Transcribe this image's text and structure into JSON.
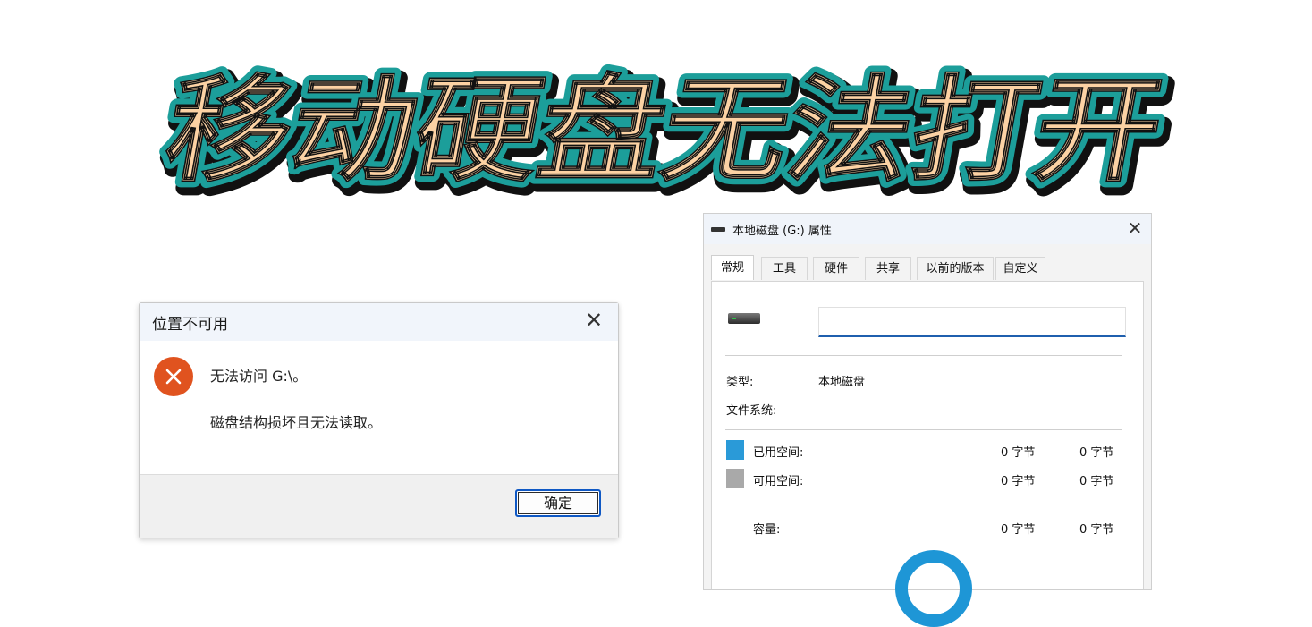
{
  "headline": "移动硬盘无法打开",
  "colors": {
    "headline_fill": "#fcd2a4",
    "headline_stroke": "#1c9e9a",
    "error_red": "#e0531f",
    "used_space": "#2a9ad8",
    "free_space": "#a9a9a9",
    "accent_blue": "#1f5fae"
  },
  "error_dialog": {
    "title": "位置不可用",
    "close_icon": "close-icon",
    "icon": "error-icon",
    "line1": "无法访问 G:\\。",
    "line2": "磁盘结构损坏且无法读取。",
    "ok_button": "确定"
  },
  "properties_dialog": {
    "title": "本地磁盘 (G:) 属性",
    "close_icon": "close-icon",
    "tabs": [
      "常规",
      "工具",
      "硬件",
      "共享",
      "以前的版本",
      "自定义"
    ],
    "active_tab": "常规",
    "volume_label_value": "",
    "type_label": "类型:",
    "type_value": "本地磁盘",
    "filesystem_label": "文件系统:",
    "filesystem_value": "",
    "used_label": "已用空间:",
    "used_bytes": "0 字节",
    "used_size": "0 字节",
    "free_label": "可用空间:",
    "free_bytes": "0 字节",
    "free_size": "0 字节",
    "capacity_label": "容量:",
    "capacity_bytes": "0 字节",
    "capacity_size": "0 字节"
  }
}
